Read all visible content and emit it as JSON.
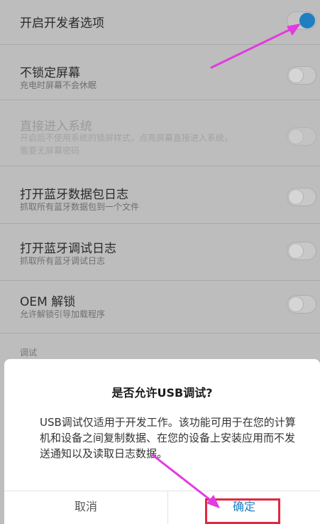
{
  "settings": {
    "developer_options": {
      "title": "开启开发者选项",
      "enabled": true
    },
    "items": [
      {
        "title": "不锁定屏幕",
        "subtitle": "充电时屏幕不会休眠",
        "enabled": false,
        "disabled": false
      },
      {
        "title": "直接进入系统",
        "subtitle_line1": "开启后不使用系统的锁屏样式，点亮屏幕直接进入系统，",
        "subtitle_line2": "需要无屏幕密码",
        "enabled": false,
        "disabled": true
      },
      {
        "title": "打开蓝牙数据包日志",
        "subtitle": "抓取所有蓝牙数据包到一个文件",
        "enabled": false,
        "disabled": false
      },
      {
        "title": "打开蓝牙调试日志",
        "subtitle": "抓取所有蓝牙调试日志",
        "enabled": false,
        "disabled": false
      },
      {
        "title": "OEM 解锁",
        "subtitle": "允许解锁引导加载程序",
        "enabled": false,
        "disabled": false
      }
    ],
    "section_label": "调试"
  },
  "dialog": {
    "title": "是否允许USB调试?",
    "message": "USB调试仅适用于开发工作。该功能可用于在您的计算机和设备之间复制数据、在您的设备上安装应用而不发送通知以及读取日志数据。",
    "cancel_label": "取消",
    "ok_label": "确定"
  },
  "colors": {
    "accent": "#1f7fc2",
    "annotation_arrow": "#e23be0",
    "annotation_box": "#e0283f"
  }
}
